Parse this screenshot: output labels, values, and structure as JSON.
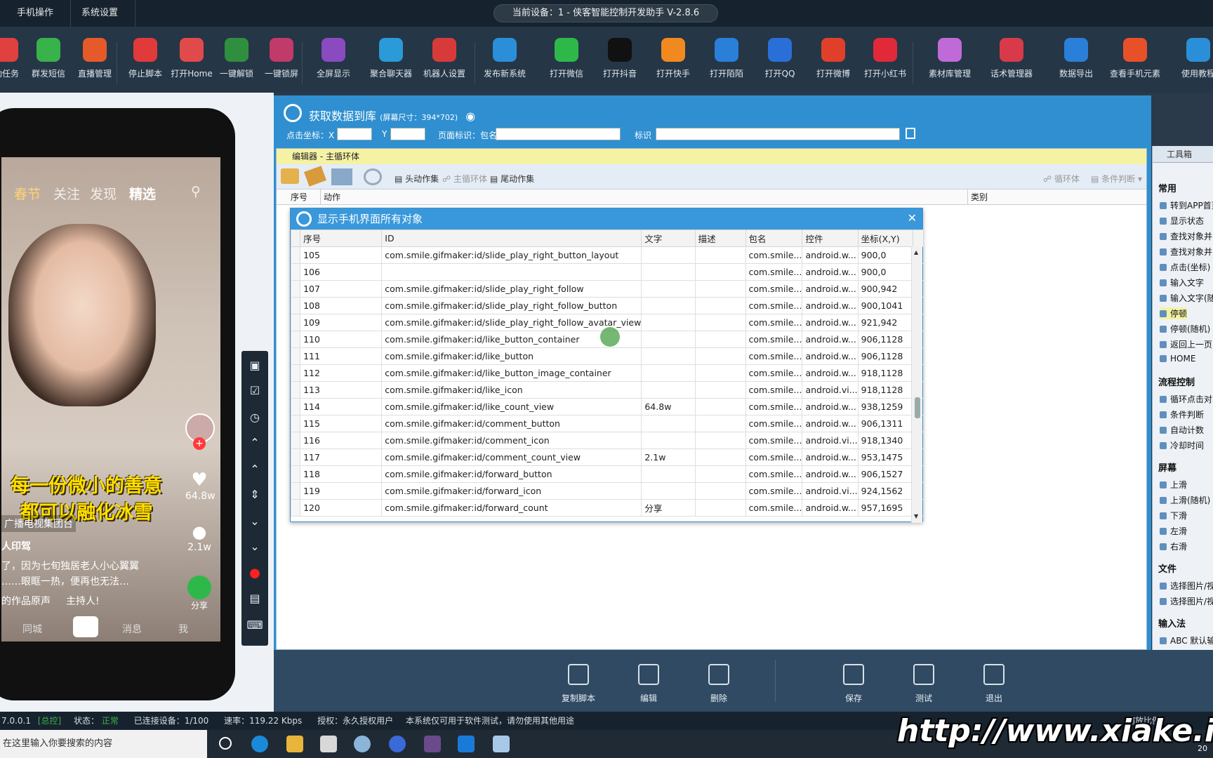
{
  "menu": {
    "tab1": "手机操作",
    "tab2": "系统设置"
  },
  "window": {
    "title": "当前设备：1 - 侠客智能控制开发助手 V-2.8.6"
  },
  "toolbar": [
    {
      "label": "动任务",
      "icon": "clock-icon",
      "color": "#e04040"
    },
    {
      "label": "群发短信",
      "icon": "chat-icon",
      "color": "#38b24a"
    },
    {
      "label": "直播管理",
      "icon": "tv-icon",
      "color": "#e65a2a"
    },
    {
      "label": "停止脚本",
      "icon": "stop-icon",
      "color": "#e03a3a"
    },
    {
      "label": "打开Home",
      "icon": "home-icon",
      "color": "#e04a4a"
    },
    {
      "label": "一键解锁",
      "icon": "unlock-icon",
      "color": "#2f8f3f"
    },
    {
      "label": "一键锁屏",
      "icon": "lock-icon",
      "color": "#c03a6a"
    },
    {
      "label": "全屏显示",
      "icon": "fullscreen-icon",
      "color": "#8a4ac0"
    },
    {
      "label": "聚合聊天器",
      "icon": "bubble-icon",
      "color": "#2a9ad8"
    },
    {
      "label": "机器人设置",
      "icon": "robot-icon",
      "color": "#d83a3a"
    },
    {
      "label": "发布新系统",
      "icon": "telegram-icon",
      "color": "#2a8fd8"
    },
    {
      "label": "打开微信",
      "icon": "wechat-icon",
      "color": "#2fb84a"
    },
    {
      "label": "打开抖音",
      "icon": "tiktok-icon",
      "color": "#111111"
    },
    {
      "label": "打开快手",
      "icon": "kuaishou-icon",
      "color": "#f08a20"
    },
    {
      "label": "打开陌陌",
      "icon": "momo-icon",
      "color": "#2a7fd8"
    },
    {
      "label": "打开QQ",
      "icon": "qq-icon",
      "color": "#2a6fd8"
    },
    {
      "label": "打开微博",
      "icon": "weibo-icon",
      "color": "#e0402a"
    },
    {
      "label": "打开小红书",
      "icon": "xiaohongshu-icon",
      "color": "#e02a3a"
    },
    {
      "label": "素材库管理",
      "icon": "flower-icon",
      "color": "#c06ad8"
    },
    {
      "label": "话术管理器",
      "icon": "speech-icon",
      "color": "#d83a4a"
    },
    {
      "label": "数据导出",
      "icon": "export-icon",
      "color": "#2a7fd8"
    },
    {
      "label": "查看手机元素",
      "icon": "share-icon",
      "color": "#e8502a"
    },
    {
      "label": "使用教程",
      "icon": "tutorial-icon",
      "color": "#2a8fd8"
    }
  ],
  "phone": {
    "tabs": [
      "春节",
      "关注",
      "发现",
      "精选"
    ],
    "caption_line1": "每一份微小的善意",
    "caption_line2": "都可以融化冰雪",
    "like_count": "64.8w",
    "comment_count": "2.1w",
    "share_label": "分享",
    "author_org": "广播电视集团台",
    "author_name": "人印驾",
    "desc1": "了，因为七旬独居老人小心翼翼",
    "desc2": "……眼眶一热，便再也无法…",
    "music1": "的作品原声",
    "music2": "主持人!",
    "nav_city": "同城",
    "nav_msg": "消息",
    "nav_me": "我"
  },
  "panel": {
    "title": "获取数据到库",
    "screen_size": "(屏幕尺寸：394*702)",
    "click_coord_label": "点击坐标：X",
    "y_label": "Y",
    "page_label": "页面标识：包名",
    "tag_label": "标识"
  },
  "editor": {
    "header": "编辑器 - 主循环体",
    "head_action": "头动作集",
    "main_loop": "主循环体",
    "tail_action": "尾动作集",
    "loop_body": "循环体",
    "cond_judge": "条件判断",
    "col_no": "序号",
    "col_action": "动作",
    "col_type": "类别"
  },
  "dialog": {
    "title": "显示手机界面所有对象",
    "columns": [
      "序号",
      "ID",
      "文字",
      "描述",
      "包名",
      "控件",
      "坐标(X,Y)"
    ],
    "rows": [
      [
        "105",
        "com.smile.gifmaker:id/slide_play_right_button_layout",
        "",
        "",
        "com.smile...",
        "android.w...",
        "900,0"
      ],
      [
        "106",
        "",
        "",
        "",
        "com.smile...",
        "android.w...",
        "900,0"
      ],
      [
        "107",
        "com.smile.gifmaker:id/slide_play_right_follow",
        "",
        "",
        "com.smile...",
        "android.w...",
        "900,942"
      ],
      [
        "108",
        "com.smile.gifmaker:id/slide_play_right_follow_button",
        "",
        "",
        "com.smile...",
        "android.w...",
        "900,1041"
      ],
      [
        "109",
        "com.smile.gifmaker:id/slide_play_right_follow_avatar_view",
        "",
        "",
        "com.smile...",
        "android.w...",
        "921,942"
      ],
      [
        "110",
        "com.smile.gifmaker:id/like_button_container",
        "",
        "",
        "com.smile...",
        "android.w...",
        "906,1128"
      ],
      [
        "111",
        "com.smile.gifmaker:id/like_button",
        "",
        "",
        "com.smile...",
        "android.w...",
        "906,1128"
      ],
      [
        "112",
        "com.smile.gifmaker:id/like_button_image_container",
        "",
        "",
        "com.smile...",
        "android.w...",
        "918,1128"
      ],
      [
        "113",
        "com.smile.gifmaker:id/like_icon",
        "",
        "",
        "com.smile...",
        "android.vi...",
        "918,1128"
      ],
      [
        "114",
        "com.smile.gifmaker:id/like_count_view",
        "64.8w",
        "",
        "com.smile...",
        "android.w...",
        "938,1259"
      ],
      [
        "115",
        "com.smile.gifmaker:id/comment_button",
        "",
        "",
        "com.smile...",
        "android.w...",
        "906,1311"
      ],
      [
        "116",
        "com.smile.gifmaker:id/comment_icon",
        "",
        "",
        "com.smile...",
        "android.vi...",
        "918,1340"
      ],
      [
        "117",
        "com.smile.gifmaker:id/comment_count_view",
        "2.1w",
        "",
        "com.smile...",
        "android.w...",
        "953,1475"
      ],
      [
        "118",
        "com.smile.gifmaker:id/forward_button",
        "",
        "",
        "com.smile...",
        "android.w...",
        "906,1527"
      ],
      [
        "119",
        "com.smile.gifmaker:id/forward_icon",
        "",
        "",
        "com.smile...",
        "android.vi...",
        "924,1562"
      ],
      [
        "120",
        "com.smile.gifmaker:id/forward_count",
        "分享",
        "",
        "com.smile...",
        "android.w...",
        "957,1695"
      ]
    ]
  },
  "toolbox": {
    "title": "工具箱",
    "sections": [
      {
        "name": "常用",
        "items": [
          "转到APP首页",
          "显示状态",
          "查找对象并",
          "查找对象并",
          "点击(坐标)",
          "输入文字",
          "输入文字(随",
          "停顿",
          "停顿(随机)",
          "返回上一页",
          "HOME"
        ]
      },
      {
        "name": "流程控制",
        "items": [
          "循环点击对",
          "条件判断",
          "自动计数",
          "冷却时间"
        ]
      },
      {
        "name": "屏幕",
        "items": [
          "上滑",
          "上滑(随机)",
          "下滑",
          "左滑",
          "右滑"
        ]
      },
      {
        "name": "文件",
        "items": [
          "选择图片/视",
          "选择图片/视"
        ]
      },
      {
        "name": "输入法",
        "items": [
          "ABC 默认输入法"
        ]
      }
    ]
  },
  "actions": [
    "复制脚本",
    "编辑",
    "删除",
    "保存",
    "测试",
    "退出"
  ],
  "status": {
    "ip": "7.0.0.1",
    "mode": "[总控]",
    "state_label": "状态：",
    "state_value": "正常",
    "connected": "已连接设备：1/100",
    "speed": "速率：119.22 Kbps",
    "license": "授权：永久授权用户",
    "notice": "本系统仅可用于软件测试，请勿使用其他用途",
    "zoom_label": "缩放比例："
  },
  "taskbar": {
    "search_placeholder": "在这里输入你要搜索的内容",
    "year": "20"
  },
  "watermark": "http://www.xiake.ink"
}
